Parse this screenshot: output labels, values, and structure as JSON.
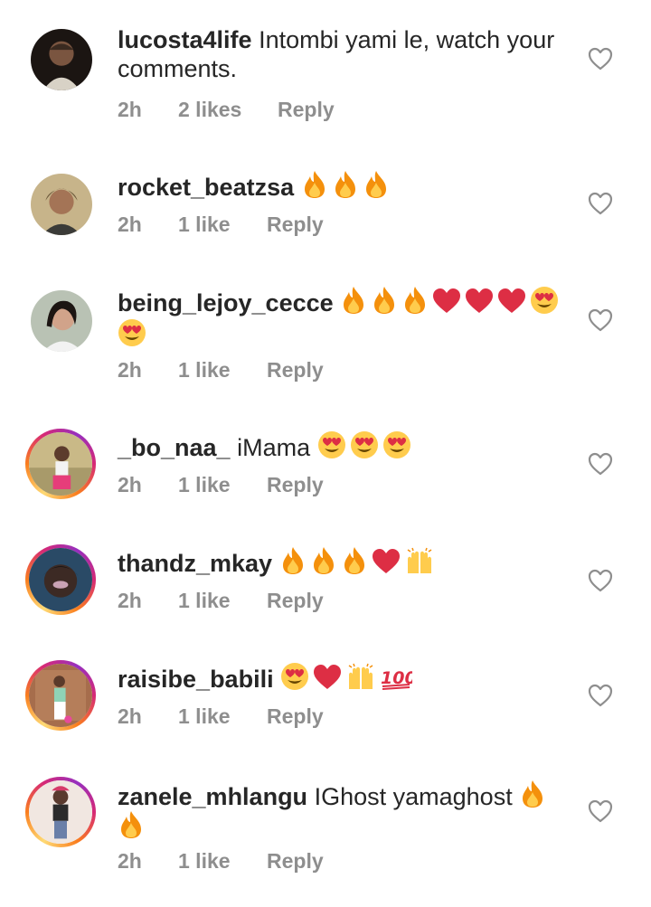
{
  "comments": [
    {
      "username": "lucosta4life",
      "text": "Intombi yami le, watch your",
      "text2": "comments.",
      "time": "2h",
      "likes": "2 likes",
      "reply": "Reply",
      "emojis": [],
      "emojis2": []
    },
    {
      "username": "rocket_beatzsa",
      "text": "",
      "text2": "",
      "time": "2h",
      "likes": "1 like",
      "reply": "Reply",
      "emojis": [
        "fire",
        "fire",
        "fire"
      ],
      "emojis2": []
    },
    {
      "username": "being_lejoy_cecce",
      "text": "",
      "text2": "",
      "time": "2h",
      "likes": "1 like",
      "reply": "Reply",
      "emojis": [
        "fire",
        "fire",
        "fire",
        "red-heart",
        "red-heart",
        "red-heart",
        "heart-eyes"
      ],
      "emojis2": [
        "heart-eyes"
      ]
    },
    {
      "username": "_bo_naa_",
      "text": "iMama",
      "text2": "",
      "time": "2h",
      "likes": "1 like",
      "reply": "Reply",
      "emojis": [
        "heart-eyes",
        "heart-eyes",
        "heart-eyes"
      ],
      "emojis2": []
    },
    {
      "username": "thandz_mkay",
      "text": "",
      "text2": "",
      "time": "2h",
      "likes": "1 like",
      "reply": "Reply",
      "emojis": [
        "fire",
        "fire",
        "fire",
        "red-heart",
        "raised-hands"
      ],
      "emojis2": []
    },
    {
      "username": "raisibe_babili",
      "text": "",
      "text2": "",
      "time": "2h",
      "likes": "1 like",
      "reply": "Reply",
      "emojis": [
        "heart-eyes",
        "red-heart",
        "raised-hands",
        "hundred"
      ],
      "emojis2": []
    },
    {
      "username": "zanele_mhlangu",
      "text": "IGhost yamaghost",
      "text2": "",
      "time": "2h",
      "likes": "1 like",
      "reply": "Reply",
      "emojis": [
        "fire"
      ],
      "emojis2": [
        "fire"
      ]
    }
  ],
  "colors": {
    "text": "#262626",
    "meta": "#8e8e8e",
    "heart_outline": "#8e8e8e"
  }
}
